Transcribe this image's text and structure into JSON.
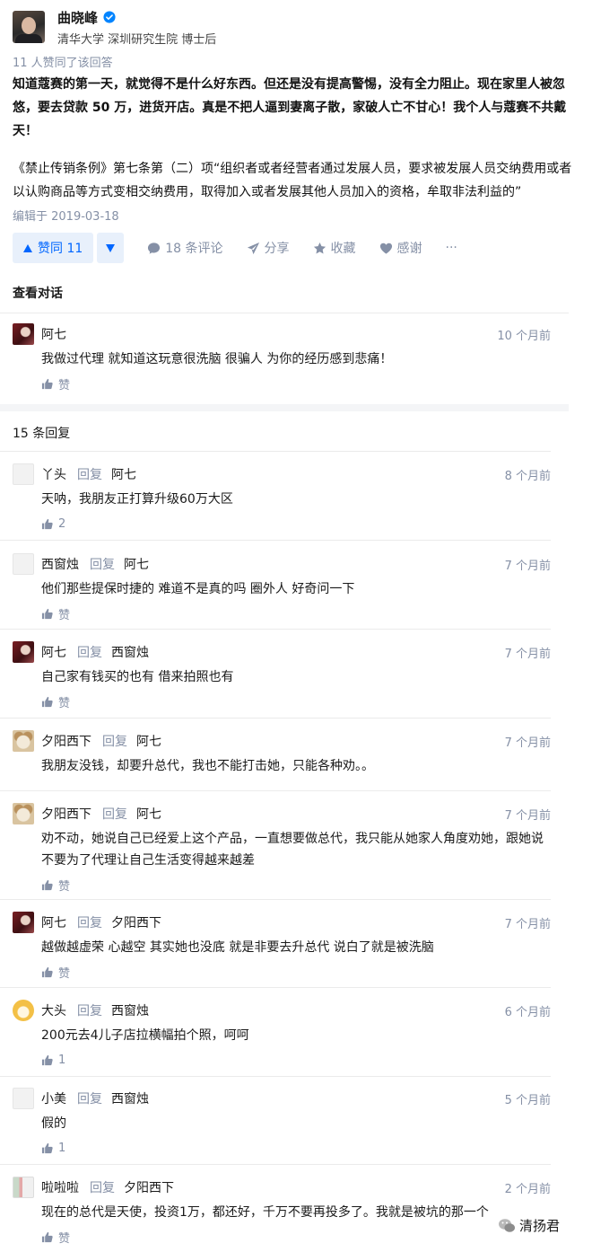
{
  "author": {
    "name": "曲晓峰",
    "title": "清华大学 深圳研究生院 博士后"
  },
  "answer": {
    "upvoters_text": "11 人赞同了该回答",
    "bold_text": "知道蔻赛的第一天，就觉得不是什么好东西。但还是没有提高警惕，没有全力阻止。现在家里人被忽悠，要去贷款 50 万，进货开店。真是不把人逼到妻离子散，家破人亡不甘心！我个人与蔻赛不共戴天！",
    "quote_text": "《禁止传销条例》第七条第（二）项“组织者或者经营者通过发展人员，要求被发展人员交纳费用或者以认购商品等方式变相交纳费用，取得加入或者发展其他人员加入的资格，牟取非法利益的”",
    "edited": "编辑于 2019-03-18"
  },
  "actions": {
    "vote_label": "赞同 11",
    "comments": "18 条评论",
    "share": "分享",
    "favorite": "收藏",
    "thanks": "感谢",
    "more": "···"
  },
  "conversation_title": "查看对话",
  "root_comment": {
    "name": "阿七",
    "time": "10 个月前",
    "body": "我做过代理 就知道这玩意很洗脑 很骗人 为你的经历感到悲痛！",
    "like": "赞"
  },
  "reply_count": "15 条回复",
  "reply_word": "回复",
  "replies": [
    {
      "name": "丫头",
      "target": "阿七",
      "time": "8 个月前",
      "body": "天呐，我朋友正打算升级60万大区",
      "like": "2"
    },
    {
      "name": "西窗烛",
      "target": "阿七",
      "time": "7 个月前",
      "body": "他们那些提保时捷的 难道不是真的吗 圈外人 好奇问一下",
      "like": "赞"
    },
    {
      "name": "阿七",
      "target": "西窗烛",
      "time": "7 个月前",
      "body": "自己家有钱买的也有 借来拍照也有",
      "like": "赞"
    },
    {
      "name": "夕阳西下",
      "target": "阿七",
      "time": "7 个月前",
      "body": "我朋友没钱，却要升总代，我也不能打击她，只能各种劝。。",
      "like": ""
    },
    {
      "name": "夕阳西下",
      "target": "阿七",
      "time": "7 个月前",
      "body": "劝不动，她说自己已经爱上这个产品，一直想要做总代，我只能从她家人角度劝她，跟她说不要为了代理让自己生活变得越来越差",
      "like": "赞"
    },
    {
      "name": "阿七",
      "target": "夕阳西下",
      "time": "7 个月前",
      "body": "越做越虚荣 心越空 其实她也没底 就是非要去升总代 说白了就是被洗脑",
      "like": "赞"
    },
    {
      "name": "大头",
      "target": "西窗烛",
      "time": "6 个月前",
      "body": "200元去4儿子店拉横幅拍个照，呵呵",
      "like": "1"
    },
    {
      "name": "小美",
      "target": "西窗烛",
      "time": "5 个月前",
      "body": "假的",
      "like": "1"
    },
    {
      "name": "啦啦啦",
      "target": "夕阳西下",
      "time": "2 个月前",
      "body": "现在的总代是天使，投资1万，都还好，千万不要再投多了。我就是被坑的那一个",
      "like": "赞"
    }
  ],
  "watermark": "清扬君",
  "colors": {
    "accent": "#0066ff",
    "muted": "#8590a6",
    "vote_bg": "#e8f0fb"
  }
}
